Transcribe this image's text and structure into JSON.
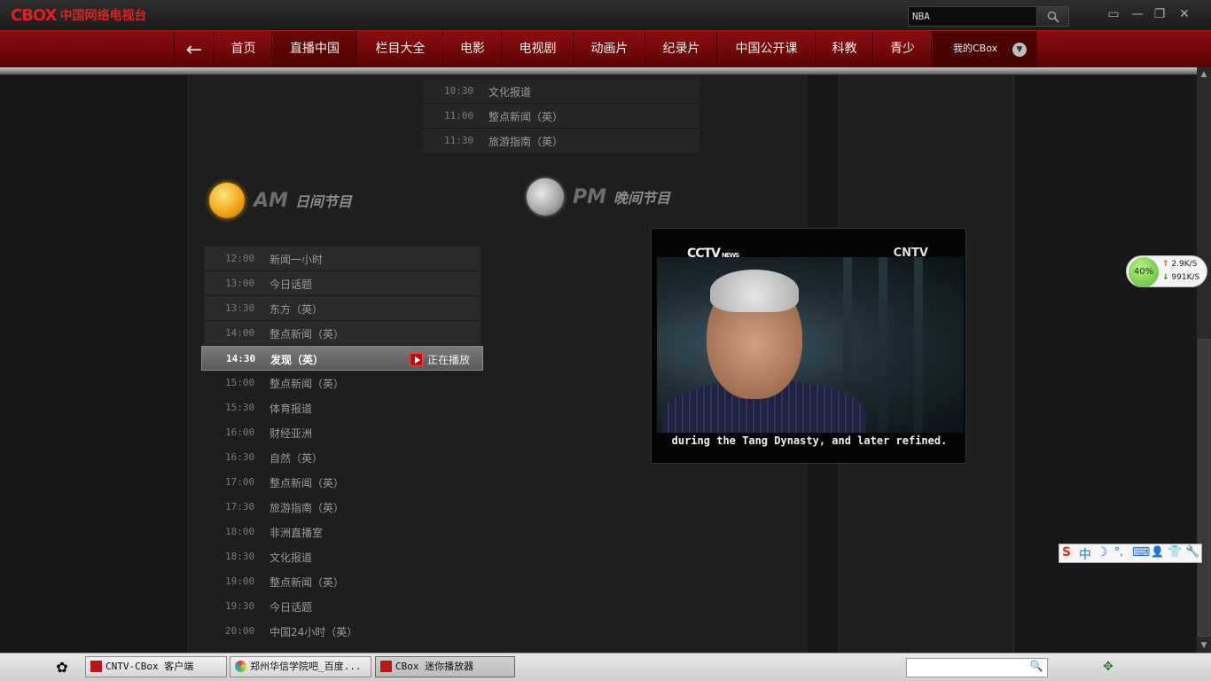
{
  "app": {
    "logo_mark": "CBOX",
    "logo_sub": "中国网络电视台"
  },
  "search": {
    "value": "NBA"
  },
  "window_controls": {
    "restore": "▭",
    "minimize": "—",
    "maximize": "❐",
    "close": "✕"
  },
  "nav": {
    "back_icon": "←",
    "items": [
      {
        "label": "首页"
      },
      {
        "label": "直播中国"
      },
      {
        "label": "栏目大全"
      },
      {
        "label": "电影"
      },
      {
        "label": "电视剧"
      },
      {
        "label": "动画片"
      },
      {
        "label": "纪录片"
      },
      {
        "label": "中国公开课"
      },
      {
        "label": "科教"
      },
      {
        "label": "青少"
      }
    ],
    "active_index": 1,
    "my_cbox": "我的CBox"
  },
  "top_schedule": [
    {
      "time": "10:30",
      "name": "文化报道"
    },
    {
      "time": "11:00",
      "name": "整点新闻（英）"
    },
    {
      "time": "11:30",
      "name": "旅游指南（英）"
    }
  ],
  "sections": {
    "am": {
      "en": "AM",
      "cn": "日间节目"
    },
    "pm": {
      "en": "PM",
      "cn": "晚间节目"
    }
  },
  "am_schedule": [
    {
      "time": "12:00",
      "name": "新闻一小时"
    },
    {
      "time": "13:00",
      "name": "今日话题"
    },
    {
      "time": "13:30",
      "name": "东方（英）"
    },
    {
      "time": "14:00",
      "name": "整点新闻（英）"
    },
    {
      "time": "14:30",
      "name": "发现（英）",
      "playing": true
    },
    {
      "time": "15:00",
      "name": "整点新闻（英）"
    },
    {
      "time": "15:30",
      "name": "体育报道"
    },
    {
      "time": "16:00",
      "name": "财经亚洲"
    },
    {
      "time": "16:30",
      "name": "自然（英）"
    },
    {
      "time": "17:00",
      "name": "整点新闻（英）"
    },
    {
      "time": "17:30",
      "name": "旅游指南（英）"
    },
    {
      "time": "18:00",
      "name": "非洲直播室"
    },
    {
      "time": "18:30",
      "name": "文化报道"
    },
    {
      "time": "19:00",
      "name": "整点新闻（英）"
    },
    {
      "time": "19:30",
      "name": "今日话题"
    },
    {
      "time": "20:00",
      "name": "中国24小时（英）"
    }
  ],
  "now_playing_label": "正在播放",
  "video": {
    "brand_left": "CCTV",
    "brand_left_sub": "NEWS",
    "brand_right": "CNTV",
    "subtitle": "during the Tang Dynasty, and later refined."
  },
  "net_widget": {
    "percent": "40%",
    "up": "2.9K/S",
    "down": "991K/S"
  },
  "ime": {
    "items": [
      "S",
      "中",
      "☽",
      "°,",
      "⌨",
      "👤",
      "👕",
      "🔧"
    ]
  },
  "taskbar": {
    "tasks": [
      {
        "label": "CNTV-CBox 客户端"
      },
      {
        "label": "郑州华信学院吧_百度..."
      },
      {
        "label": "CBox 迷你播放器"
      }
    ]
  }
}
